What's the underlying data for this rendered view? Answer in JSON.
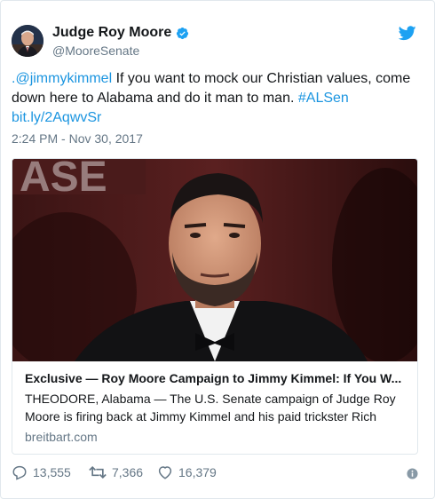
{
  "author": {
    "name": "Judge Roy Moore",
    "handle": "@MooreSenate"
  },
  "tweet": {
    "mention": ".@jimmykimmel",
    "body": " If you want to mock our Christian values, come down here to Alabama and do it man to man. ",
    "hashtag": "#ALSen",
    "short_link": "bit.ly/2AqwvSr",
    "timestamp": "2:24 PM - Nov 30, 2017"
  },
  "card": {
    "title": "Exclusive — Roy Moore Campaign to Jimmy Kimmel: If You W...",
    "description": "THEODORE, Alabama — The U.S. Senate campaign of Judge Roy Moore is firing back at Jimmy Kimmel and his paid trickster Rich",
    "domain": "breitbart.com"
  },
  "actions": {
    "replies": "13,555",
    "retweets": "7,366",
    "likes": "16,379"
  },
  "colors": {
    "link": "#1b95e0",
    "muted": "#657786",
    "border": "#e1e8ed",
    "verified": "#1da1f2"
  },
  "icons": [
    "twitter-bird-icon",
    "verified-badge-icon",
    "reply-icon",
    "retweet-icon",
    "heart-icon",
    "info-icon"
  ]
}
